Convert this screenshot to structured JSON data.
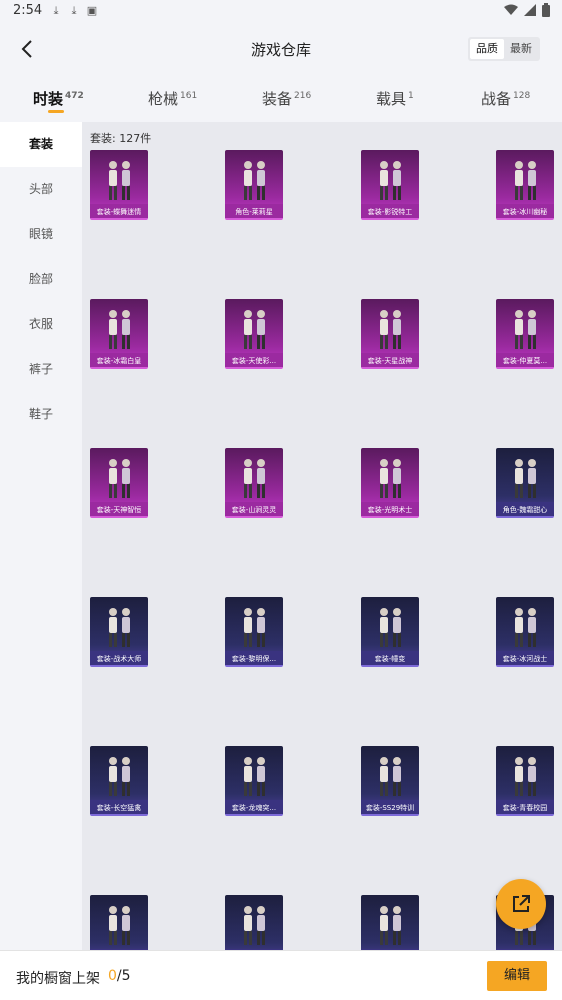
{
  "status_bar": {
    "time": "2:54"
  },
  "header": {
    "title": "游戏仓库",
    "sort_options": [
      "品质",
      "最新"
    ],
    "sort_active": 0
  },
  "tabs": [
    {
      "label": "时装",
      "count": "472"
    },
    {
      "label": "枪械",
      "count": "161"
    },
    {
      "label": "装备",
      "count": "216"
    },
    {
      "label": "载具",
      "count": "1"
    },
    {
      "label": "战备",
      "count": "128"
    }
  ],
  "sidebar": {
    "items": [
      "套装",
      "头部",
      "眼镜",
      "脸部",
      "衣服",
      "裤子",
      "鞋子"
    ]
  },
  "content": {
    "count_label": "套装: 127件"
  },
  "items": [
    {
      "name": "套装-蝶舞迷情",
      "rarity": "purple"
    },
    {
      "name": "角色-莱莉星",
      "rarity": "purple"
    },
    {
      "name": "套装-影锐特工",
      "rarity": "purple"
    },
    {
      "name": "套装-冰川幽秘",
      "rarity": "purple"
    },
    {
      "name": "套装-冰霜白皇",
      "rarity": "purple"
    },
    {
      "name": "套装-天使彩...",
      "rarity": "purple"
    },
    {
      "name": "套装-天星战神",
      "rarity": "purple"
    },
    {
      "name": "套装-仲夏莫...",
      "rarity": "purple"
    },
    {
      "name": "套装-天神智恒",
      "rarity": "purple"
    },
    {
      "name": "套装-山涧灵灵",
      "rarity": "purple"
    },
    {
      "name": "套装-光明术士",
      "rarity": "purple"
    },
    {
      "name": "角色-魏霜甜心",
      "rarity": "blue"
    },
    {
      "name": "套装-战术大师",
      "rarity": "blue"
    },
    {
      "name": "套装-黎明保...",
      "rarity": "blue"
    },
    {
      "name": "套装-幢变",
      "rarity": "blue"
    },
    {
      "name": "套装-冰河战士",
      "rarity": "blue"
    },
    {
      "name": "套装-长空猛禽",
      "rarity": "blue"
    },
    {
      "name": "套装-龙魂突...",
      "rarity": "blue"
    },
    {
      "name": "套装-SS29特训",
      "rarity": "blue"
    },
    {
      "name": "套装-青春校园",
      "rarity": "blue"
    },
    {
      "name": "",
      "rarity": "blue"
    },
    {
      "name": "",
      "rarity": "blue"
    },
    {
      "name": "",
      "rarity": "blue"
    },
    {
      "name": "",
      "rarity": "blue"
    }
  ],
  "bottom_bar": {
    "label": "我的橱窗上架",
    "shelved": "0",
    "total": "/5",
    "edit_label": "编辑"
  },
  "colors": {
    "accent": "#f5a623",
    "purple_card": "#9b2aa0",
    "blue_card": "#3a3380"
  }
}
